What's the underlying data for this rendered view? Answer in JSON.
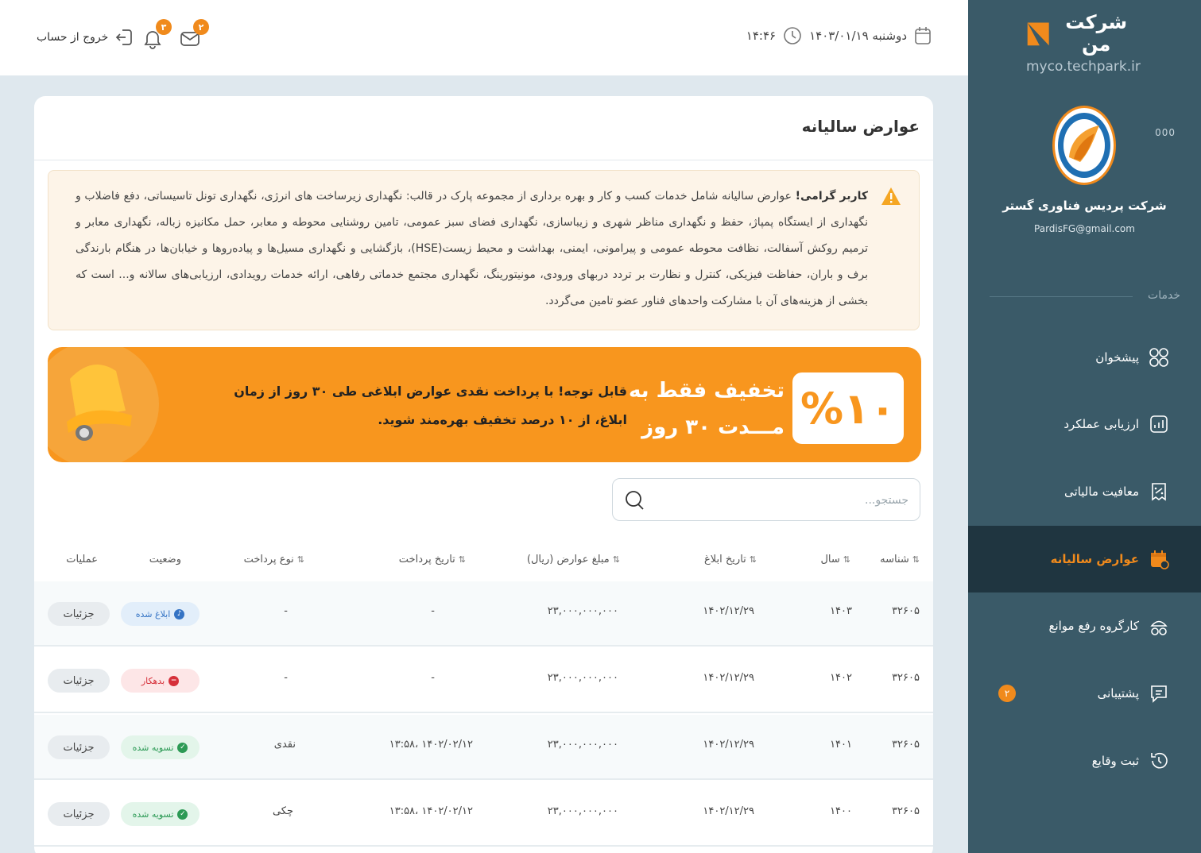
{
  "sidebar": {
    "brand": "شرکت من",
    "url": "myco.techpark.ir",
    "more": "000",
    "company_name": "شرکت پردیس فناوری گستر",
    "company_email": "PardisFG@gmail.com",
    "section_label": "خدمات",
    "items": [
      {
        "label": "پیشخوان",
        "icon": "grid-icon"
      },
      {
        "label": "ارزیابی عملکرد",
        "icon": "chart-icon"
      },
      {
        "label": "معافیت مالیاتی",
        "icon": "receipt-icon"
      },
      {
        "label": "عوارض سالیانه",
        "icon": "calendar-icon",
        "active": true
      },
      {
        "label": "کارگروه رفع موانع",
        "icon": "group-icon"
      },
      {
        "label": "پشتیبانی",
        "icon": "chat-icon",
        "badge": "۲"
      },
      {
        "label": "ثبت وقایع",
        "icon": "history-icon"
      }
    ]
  },
  "header": {
    "date": "دوشنبه ۱۴۰۳/۰۱/۱۹",
    "time": "۱۴:۴۶",
    "logout_label": "خروج از حساب",
    "notifications_count": "۳",
    "messages_count": "۲"
  },
  "page": {
    "title": "عوارض سالیانه",
    "notice_bold": "کاربر گرامی!",
    "notice_text": " عوارض سالیانه شامل خدمات کسب و کار و بهره برداری از مجموعه پارک در قالب: نگهداری زیرساخت های انرژی، نگهداری تونل تاسیساتی، دفع فاضلاب و نگهداری از ایستگاه پمپاژ، حفظ و نگهداری مناظر شهری و زیباسازی، نگهداری فضای سبز عمومی، تامین روشنایی محوطه و معابر، حمل مکانیزه زباله، نگهداری معابر و ترمیم روکش آسفالت، نظافت محوطه عمومی و پیرامونی، ایمنی، بهداشت و محیط زیست(HSE)، بازگشایی و نگهداری مسیل‌ها و پیاده‌روها و خیابان‌ها در هنگام بارندگی برف و باران، حفاظت فیزیکی، کنترل و نظارت بر تردد دربهای ورودی، مونیتورینگ، نگهداری مجتمع خدماتی رفاهی، ارائه خدمات رویدادی، ارزیابی‌های سالانه و... است که بخشی از هزینه‌های آن با مشارکت واحدهای فناور عضو تامین می‌گردد.",
    "banner_percent": "%۱۰",
    "banner_headline_1": "تخفیف فقط به",
    "banner_headline_2": "مـــدت ۳۰ روز",
    "banner_text": "قابل توجه! با پرداخت نقدی عوارض ابلاغی طی ۳۰ روز از زمان ابلاغ، از ۱۰ درصد تخفیف بهره‌مند شوید.",
    "search_placeholder": "جستجو..."
  },
  "table": {
    "headers": {
      "id": "شناسه",
      "year": "سال",
      "notice_date": "تاریخ ابلاغ",
      "amount": "مبلغ عوارض (ریال)",
      "pay_date": "تاریخ پرداخت",
      "pay_type": "نوع پرداخت",
      "status": "وضعیت",
      "actions": "عملیات"
    },
    "rows": [
      {
        "id": "۳۲۶۰۵",
        "year": "۱۴۰۳",
        "notice_date": "۱۴۰۲/۱۲/۲۹",
        "amount": "۲۳,۰۰۰,۰۰۰,۰۰۰",
        "pay_date": "-",
        "pay_type": "-",
        "status": "ابلاغ شده",
        "status_kind": "notified",
        "action": "جزئیات"
      },
      {
        "id": "۳۲۶۰۵",
        "year": "۱۴۰۲",
        "notice_date": "۱۴۰۲/۱۲/۲۹",
        "amount": "۲۳,۰۰۰,۰۰۰,۰۰۰",
        "pay_date": "-",
        "pay_type": "-",
        "status": "بدهکار",
        "status_kind": "debtor",
        "action": "جزئیات"
      },
      {
        "id": "۳۲۶۰۵",
        "year": "۱۴۰۱",
        "notice_date": "۱۴۰۲/۱۲/۲۹",
        "amount": "۲۳,۰۰۰,۰۰۰,۰۰۰",
        "pay_date": "۱۴۰۲/۰۲/۱۲ ،۱۳:۵۸",
        "pay_type": "نقدی",
        "status": "تسویه شده",
        "status_kind": "settled",
        "action": "جزئیات"
      },
      {
        "id": "۳۲۶۰۵",
        "year": "۱۴۰۰",
        "notice_date": "۱۴۰۲/۱۲/۲۹",
        "amount": "۲۳,۰۰۰,۰۰۰,۰۰۰",
        "pay_date": "۱۴۰۲/۰۲/۱۲ ،۱۳:۵۸",
        "pay_type": "چکی",
        "status": "تسویه شده",
        "status_kind": "settled",
        "action": "جزئیات"
      }
    ]
  },
  "colors": {
    "accent": "#f08a1c",
    "sidebar": "#3a5a68",
    "sidebar_active": "#1f3540",
    "banner": "#f8961e"
  }
}
